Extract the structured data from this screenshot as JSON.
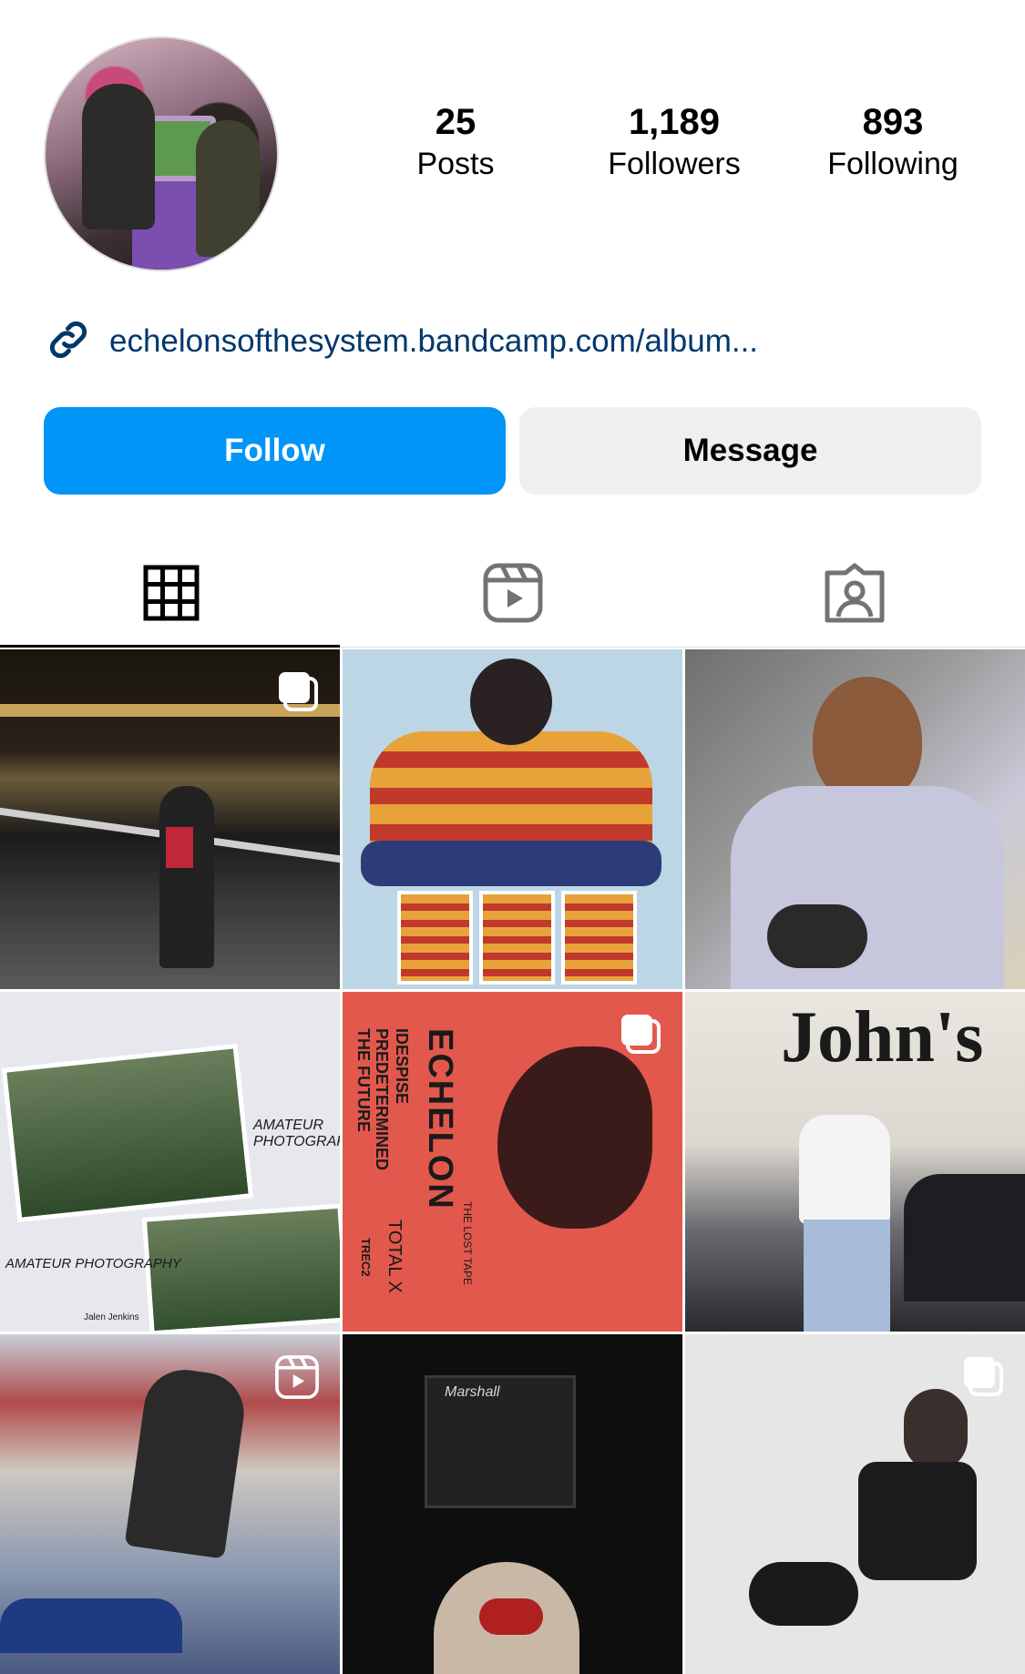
{
  "profile": {
    "stats": [
      {
        "value": "25",
        "label": "Posts"
      },
      {
        "value": "1,189",
        "label": "Followers"
      },
      {
        "value": "893",
        "label": "Following"
      }
    ],
    "link": "echelonsofthesystem.bandcamp.com/album..."
  },
  "actions": {
    "follow_label": "Follow",
    "message_label": "Message"
  },
  "tabs": [
    {
      "icon": "grid-icon",
      "active": true
    },
    {
      "icon": "reels-icon",
      "active": false
    },
    {
      "icon": "tagged-icon",
      "active": false
    }
  ],
  "posts": [
    {
      "badge": "carousel-icon"
    },
    {
      "badge": ""
    },
    {
      "badge": ""
    },
    {
      "badge": "",
      "text": [
        "AMATEUR PHOTOGRAPHY",
        "AMATEUR PHOTOGRAPHY",
        "Jalen Jenkins"
      ]
    },
    {
      "badge": "carousel-icon",
      "text": [
        "ECHELON",
        "THE LOST TAPE",
        "IDESPISE",
        "PREDETERMINED",
        "THE FUTURE",
        "TOTAL X",
        "TREC2"
      ]
    },
    {
      "badge": "",
      "text": [
        "John's"
      ]
    },
    {
      "badge": "reels-icon"
    },
    {
      "badge": "",
      "text": [
        "Marshall"
      ]
    },
    {
      "badge": "carousel-icon"
    }
  ],
  "colors": {
    "follow_blue": "#0095f6",
    "link_blue": "#00376b",
    "message_gray": "#efefef"
  }
}
